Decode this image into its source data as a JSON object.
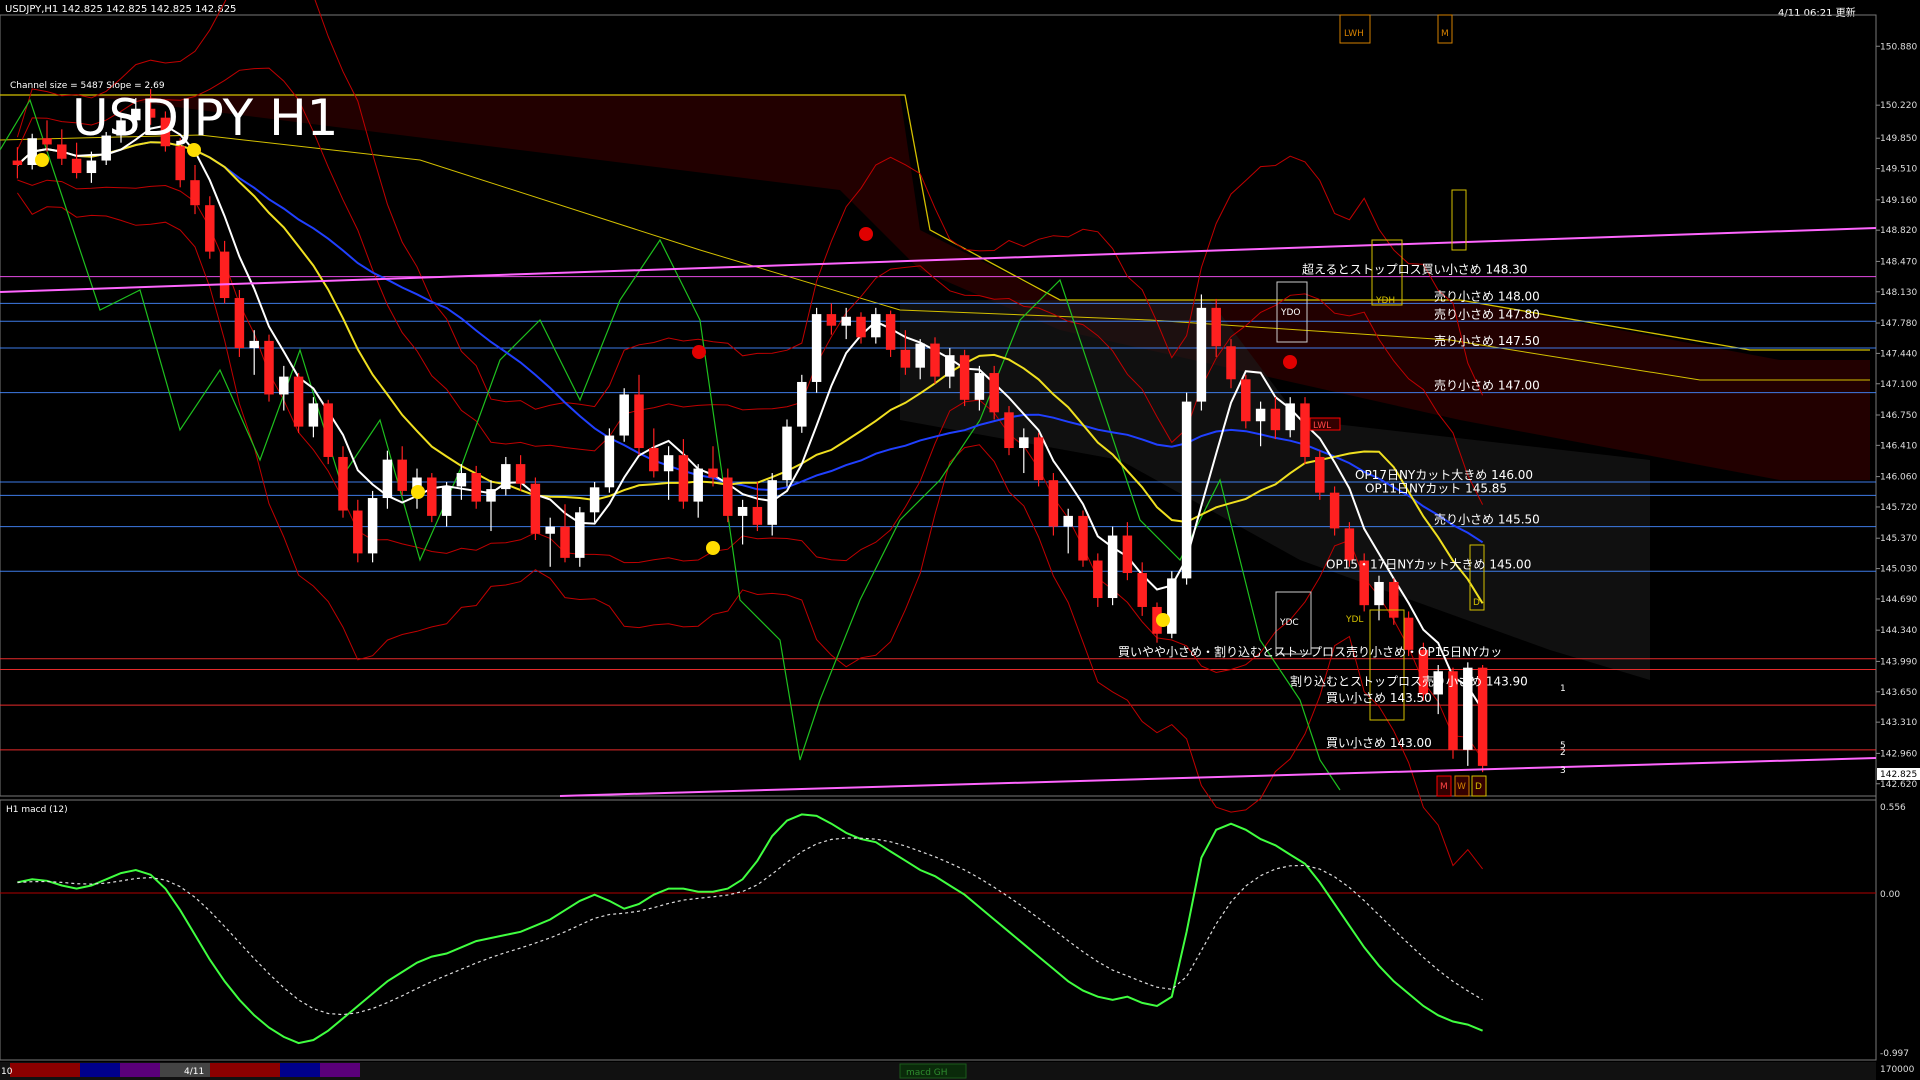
{
  "header": {
    "symbol_info": "USDJPY,H1  142.825 142.825 142.825 142.825",
    "datetime": "4/11 06:21 更新",
    "channel_info": "Channel size = 5487 Slope = 2.69",
    "big_title": "USDJPY H1"
  },
  "price_axis": {
    "labels": [
      "150.880",
      "150.220",
      "149.850",
      "149.510",
      "149.160",
      "148.820",
      "148.470",
      "148.130",
      "147.780",
      "147.440",
      "147.100",
      "146.750",
      "146.410",
      "146.060",
      "145.720",
      "145.370",
      "145.030",
      "144.690",
      "144.340",
      "143.990",
      "143.650",
      "143.310",
      "142.960",
      "142.620"
    ],
    "current_price": "142.825"
  },
  "levels": [
    {
      "text": "超えるとストップロス買い小さめ 148.30",
      "color": "#ff55ff"
    },
    {
      "text": "売り小さめ 148.00",
      "color": "#4488ff"
    },
    {
      "text": "売り小さめ 147.80",
      "color": "#4488ff"
    },
    {
      "text": "売り小さめ 147.50",
      "color": "#4488ff"
    },
    {
      "text": "売り小さめ 147.00",
      "color": "#4488ff"
    },
    {
      "text": "OP17日NYカット大きめ 146.00",
      "color": "#4488ff"
    },
    {
      "text": "OP11日NYカット 145.85",
      "color": "#4488ff"
    },
    {
      "text": "売り小さめ 145.50",
      "color": "#4488ff"
    },
    {
      "text": "OP15・17日NYカット大きめ 145.00",
      "color": "#4488ff"
    },
    {
      "text": "買いやや小さめ・割り込むとストップロス売り小さめ・OP15日NYカッ",
      "color": "#ff3030"
    },
    {
      "text": "割り込むとストップロス売り小さめ 143.90",
      "color": "#ff3030"
    },
    {
      "text": "買い小さめ 143.50",
      "color": "#ff3030"
    },
    {
      "text": "買い小さめ 143.00",
      "color": "#ff3030"
    }
  ],
  "markers": {
    "lwh": "LWH",
    "m_top": "M",
    "ydo": "YDO",
    "ydh": "YDH",
    "ydc": "YDC",
    "ydl": "YDL",
    "lwl": "LWL",
    "m": "M",
    "w": "W",
    "d": "D",
    "n1": "1",
    "n2": "2",
    "n3": "3",
    "n5": "5"
  },
  "indicator": {
    "title": "H1  macd (12)",
    "axis_top": "0.556",
    "axis_zero": "0.00",
    "axis_bottom": "-0.997",
    "axis_volume": "170000"
  },
  "timebar": {
    "left_label": "10",
    "date_label": "4/11",
    "tab_label": "macd GH"
  },
  "chart_data": {
    "type": "candlestick",
    "title": "USDJPY H1",
    "ylim": [
      142.45,
      151.05
    ],
    "ohlc": [
      [
        149.6,
        149.75,
        149.4,
        149.55
      ],
      [
        149.55,
        149.9,
        149.5,
        149.85
      ],
      [
        149.85,
        150.05,
        149.7,
        149.78
      ],
      [
        149.78,
        149.95,
        149.55,
        149.62
      ],
      [
        149.62,
        149.8,
        149.4,
        149.46
      ],
      [
        149.46,
        149.7,
        149.35,
        149.6
      ],
      [
        149.6,
        149.92,
        149.55,
        149.88
      ],
      [
        149.88,
        150.12,
        149.8,
        150.05
      ],
      [
        150.05,
        150.3,
        149.95,
        150.18
      ],
      [
        150.18,
        150.4,
        150.0,
        150.08
      ],
      [
        150.08,
        150.15,
        149.7,
        149.76
      ],
      [
        149.76,
        149.85,
        149.3,
        149.38
      ],
      [
        149.38,
        149.55,
        149.0,
        149.1
      ],
      [
        149.1,
        149.2,
        148.5,
        148.58
      ],
      [
        148.58,
        148.7,
        148.0,
        148.06
      ],
      [
        148.06,
        148.15,
        147.4,
        147.5
      ],
      [
        147.5,
        147.7,
        147.2,
        147.58
      ],
      [
        147.58,
        147.65,
        146.9,
        146.98
      ],
      [
        146.98,
        147.3,
        146.8,
        147.18
      ],
      [
        147.18,
        147.22,
        146.55,
        146.62
      ],
      [
        146.62,
        146.95,
        146.5,
        146.88
      ],
      [
        146.88,
        146.92,
        146.2,
        146.28
      ],
      [
        146.28,
        146.4,
        145.6,
        145.68
      ],
      [
        145.68,
        145.8,
        145.1,
        145.2
      ],
      [
        145.2,
        145.9,
        145.1,
        145.82
      ],
      [
        145.82,
        146.35,
        145.7,
        146.25
      ],
      [
        146.25,
        146.4,
        145.85,
        145.9
      ],
      [
        145.9,
        146.15,
        145.7,
        146.05
      ],
      [
        146.05,
        146.1,
        145.55,
        145.62
      ],
      [
        145.62,
        146.0,
        145.5,
        145.95
      ],
      [
        145.95,
        146.2,
        145.8,
        146.1
      ],
      [
        146.1,
        146.18,
        145.7,
        145.78
      ],
      [
        145.78,
        146.02,
        145.45,
        145.92
      ],
      [
        145.92,
        146.28,
        145.85,
        146.2
      ],
      [
        146.2,
        146.3,
        145.9,
        145.98
      ],
      [
        145.98,
        146.05,
        145.35,
        145.42
      ],
      [
        145.42,
        145.6,
        145.05,
        145.5
      ],
      [
        145.5,
        145.75,
        145.1,
        145.15
      ],
      [
        145.15,
        145.72,
        145.05,
        145.66
      ],
      [
        145.66,
        146.0,
        145.55,
        145.94
      ],
      [
        145.94,
        146.6,
        145.88,
        146.52
      ],
      [
        146.52,
        147.05,
        146.45,
        146.98
      ],
      [
        146.98,
        147.2,
        146.3,
        146.38
      ],
      [
        146.38,
        146.6,
        146.05,
        146.12
      ],
      [
        146.12,
        146.4,
        145.8,
        146.3
      ],
      [
        146.3,
        146.48,
        145.7,
        145.78
      ],
      [
        145.78,
        146.2,
        145.6,
        146.15
      ],
      [
        146.15,
        146.4,
        145.95,
        146.05
      ],
      [
        146.05,
        146.15,
        145.55,
        145.62
      ],
      [
        145.62,
        145.8,
        145.3,
        145.72
      ],
      [
        145.72,
        146.0,
        145.45,
        145.52
      ],
      [
        145.52,
        146.1,
        145.4,
        146.02
      ],
      [
        146.02,
        146.7,
        145.95,
        146.62
      ],
      [
        146.62,
        147.2,
        146.55,
        147.12
      ],
      [
        147.12,
        147.95,
        147.0,
        147.88
      ],
      [
        147.88,
        148.0,
        147.65,
        147.75
      ],
      [
        147.75,
        147.95,
        147.6,
        147.85
      ],
      [
        147.85,
        147.9,
        147.55,
        147.62
      ],
      [
        147.62,
        147.95,
        147.55,
        147.88
      ],
      [
        147.88,
        147.92,
        147.4,
        147.48
      ],
      [
        147.48,
        147.7,
        147.2,
        147.28
      ],
      [
        147.28,
        147.6,
        147.15,
        147.55
      ],
      [
        147.55,
        147.62,
        147.1,
        147.18
      ],
      [
        147.18,
        147.5,
        147.05,
        147.42
      ],
      [
        147.42,
        147.48,
        146.85,
        146.92
      ],
      [
        146.92,
        147.3,
        146.8,
        147.22
      ],
      [
        147.22,
        147.3,
        146.7,
        146.78
      ],
      [
        146.78,
        146.85,
        146.3,
        146.38
      ],
      [
        146.38,
        146.6,
        146.1,
        146.5
      ],
      [
        146.5,
        146.55,
        145.95,
        146.02
      ],
      [
        146.02,
        146.1,
        145.4,
        145.5
      ],
      [
        145.5,
        145.7,
        145.2,
        145.62
      ],
      [
        145.62,
        145.68,
        145.05,
        145.12
      ],
      [
        145.12,
        145.2,
        144.6,
        144.7
      ],
      [
        144.7,
        145.5,
        144.62,
        145.4
      ],
      [
        145.4,
        145.55,
        144.9,
        144.98
      ],
      [
        144.98,
        145.1,
        144.5,
        144.6
      ],
      [
        144.6,
        144.65,
        144.2,
        144.3
      ],
      [
        144.3,
        145.0,
        144.25,
        144.92
      ],
      [
        144.92,
        147.0,
        144.85,
        146.9
      ],
      [
        146.9,
        148.1,
        146.8,
        147.95
      ],
      [
        147.95,
        148.05,
        147.4,
        147.52
      ],
      [
        147.52,
        147.6,
        147.05,
        147.15
      ],
      [
        147.15,
        147.2,
        146.6,
        146.68
      ],
      [
        146.68,
        146.9,
        146.4,
        146.82
      ],
      [
        146.82,
        146.95,
        146.48,
        146.58
      ],
      [
        146.58,
        146.95,
        146.5,
        146.88
      ],
      [
        146.88,
        146.95,
        146.2,
        146.28
      ],
      [
        146.28,
        146.35,
        145.8,
        145.88
      ],
      [
        145.88,
        145.95,
        145.4,
        145.48
      ],
      [
        145.48,
        145.55,
        145.05,
        145.12
      ],
      [
        145.12,
        145.2,
        144.55,
        144.62
      ],
      [
        144.62,
        144.95,
        144.45,
        144.88
      ],
      [
        144.88,
        144.92,
        144.4,
        144.48
      ],
      [
        144.48,
        144.55,
        144.05,
        144.12
      ],
      [
        144.12,
        144.2,
        143.55,
        143.62
      ],
      [
        143.62,
        143.95,
        143.4,
        143.88
      ],
      [
        143.88,
        143.92,
        142.9,
        143.0
      ],
      [
        143.0,
        143.98,
        142.82,
        143.92
      ],
      [
        143.92,
        143.95,
        142.75,
        142.82
      ]
    ],
    "ma_series": [
      {
        "color": "#ffffff"
      },
      {
        "color": "#ffff00"
      },
      {
        "color": "#3030ff"
      }
    ],
    "macd": [
      0.12,
      0.14,
      0.13,
      0.1,
      0.08,
      0.1,
      0.14,
      0.18,
      0.2,
      0.17,
      0.08,
      -0.06,
      -0.22,
      -0.38,
      -0.52,
      -0.64,
      -0.74,
      -0.82,
      -0.88,
      -0.92,
      -0.9,
      -0.84,
      -0.76,
      -0.68,
      -0.6,
      -0.52,
      -0.46,
      -0.4,
      -0.36,
      -0.34,
      -0.3,
      -0.26,
      -0.24,
      -0.22,
      -0.2,
      -0.16,
      -0.12,
      -0.06,
      0.0,
      0.04,
      0.0,
      -0.05,
      -0.02,
      0.04,
      0.08,
      0.08,
      0.06,
      0.06,
      0.08,
      0.14,
      0.26,
      0.42,
      0.52,
      0.56,
      0.55,
      0.5,
      0.44,
      0.4,
      0.38,
      0.32,
      0.26,
      0.2,
      0.16,
      0.1,
      0.04,
      -0.04,
      -0.12,
      -0.2,
      -0.28,
      -0.36,
      -0.44,
      -0.52,
      -0.58,
      -0.62,
      -0.64,
      -0.62,
      -0.66,
      -0.68,
      -0.62,
      -0.2,
      0.28,
      0.46,
      0.5,
      0.46,
      0.4,
      0.36,
      0.3,
      0.24,
      0.12,
      -0.02,
      -0.16,
      -0.3,
      -0.42,
      -0.52,
      -0.6,
      -0.68,
      -0.74,
      -0.78,
      -0.8,
      -0.84
    ]
  }
}
